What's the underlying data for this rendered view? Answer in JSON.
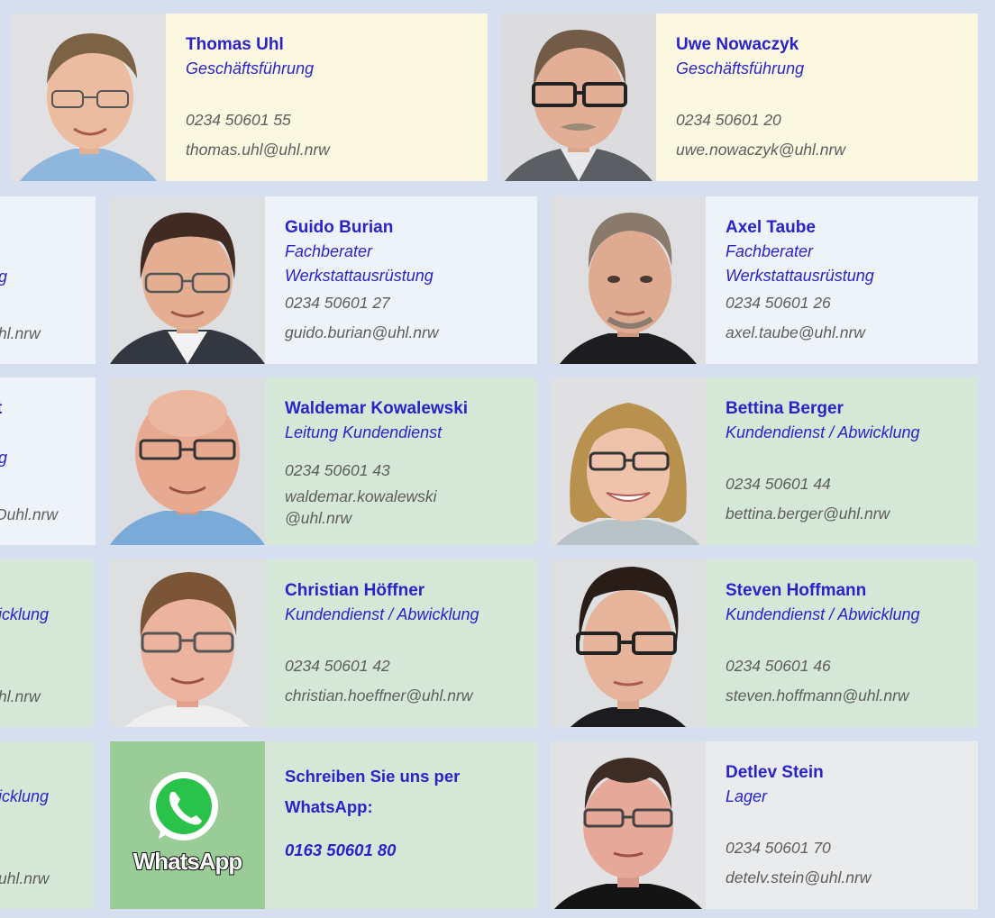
{
  "cards": {
    "thomas": {
      "name": "Thomas Uhl",
      "role": "Geschäftsführung",
      "phone": "0234 50601 55",
      "email": "thomas.uhl@uhl.nrw"
    },
    "uwe": {
      "name": "Uwe Nowaczyk",
      "role": "Geschäftsführung",
      "phone": "0234 50601 20",
      "email": "uwe.nowaczyk@uhl.nrw"
    },
    "guido": {
      "name": "Guido Burian",
      "role1": "Fachberater",
      "role2": "Werkstattausrüstung",
      "phone": "0234 50601 27",
      "email": "guido.burian@uhl.nrw"
    },
    "axel": {
      "name": "Axel Taube",
      "role1": "Fachberater",
      "role2": "Werkstattausrüstung",
      "phone": "0234 50601 26",
      "email": "axel.taube@uhl.nrw"
    },
    "waldemar": {
      "name": "Waldemar Kowalewski",
      "role": "Leitung Kundendienst",
      "phone": "0234 50601 43",
      "email1": "waldemar.kowalewski",
      "email2": "@uhl.nrw"
    },
    "bettina": {
      "name": "Bettina Berger",
      "role": "Kundendienst / Abwicklung",
      "phone": "0234 50601 44",
      "email": "bettina.berger@uhl.nrw"
    },
    "christian": {
      "name": "Christian Höffner",
      "role": "Kundendienst / Abwicklung",
      "phone": "0234 50601 42",
      "email": "christian.hoeffner@uhl.nrw"
    },
    "steven": {
      "name": "Steven Hoffmann",
      "role": "Kundendienst / Abwicklung",
      "phone": "0234 50601 46",
      "email": "steven.hoffmann@uhl.nrw"
    },
    "whatsapp": {
      "text1": "Schreiben Sie uns per",
      "text2": "WhatsApp:",
      "phone": "0163 50601 80",
      "logo_text": "WhatsApp"
    },
    "detlev": {
      "name": "Detlev Stein",
      "role": "Lager",
      "phone": "0234 50601 70",
      "email": "detelv.stein@uhl.nrw"
    }
  },
  "partials": {
    "row2": {
      "role": "g",
      "email": "hl.nrw"
    },
    "row3": {
      "name": "t",
      "role": "g",
      "email": "Ouhl.nrw"
    },
    "row4": {
      "role": "icklung",
      "email": "hl.nrw"
    },
    "row5": {
      "role": "icklung",
      "email": "uhl.nrw"
    }
  },
  "colors": {
    "accent": "#2a23c9",
    "text": "#5d5d5d",
    "yellow": "#fbf8e1",
    "blue": "#eef3fa",
    "green": "#d5e8d8",
    "grey": "#e9ebec",
    "whatsapp": "#25d366"
  },
  "icons": {
    "whatsapp": "whatsapp-icon"
  }
}
